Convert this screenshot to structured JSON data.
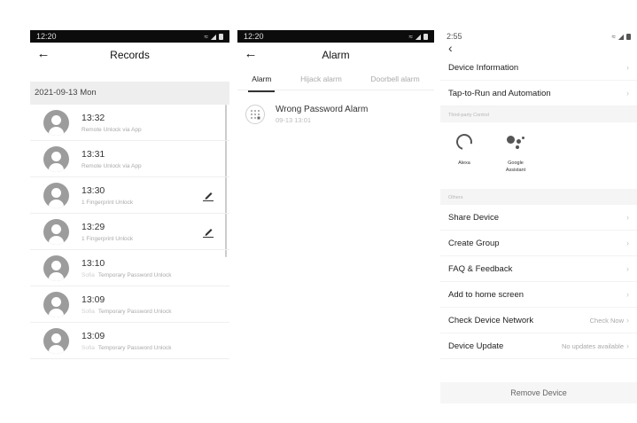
{
  "records_screen": {
    "status_time": "12:20",
    "title": "Records",
    "date_header": "2021-09-13 Mon",
    "records": [
      {
        "time": "13:32",
        "user": "",
        "method": "Remote Unlock via App",
        "editable": false
      },
      {
        "time": "13:31",
        "user": "",
        "method": "Remote Unlock via App",
        "editable": false
      },
      {
        "time": "13:30",
        "user": "",
        "method": "1 Fingerprint Unlock",
        "editable": true
      },
      {
        "time": "13:29",
        "user": "",
        "method": "1 Fingerprint Unlock",
        "editable": true
      },
      {
        "time": "13:10",
        "user": "Sofia",
        "method": "Temporary Password Unlock",
        "editable": false
      },
      {
        "time": "13:09",
        "user": "Sofia",
        "method": "Temporary Password Unlock",
        "editable": false
      },
      {
        "time": "13:09",
        "user": "Sofia",
        "method": "Temporary Password Unlock",
        "editable": false
      }
    ]
  },
  "alarm_screen": {
    "status_time": "12:20",
    "title": "Alarm",
    "tabs": [
      "Alarm",
      "Hijack alarm",
      "Doorbell alarm"
    ],
    "active_tab": 0,
    "alarms": [
      {
        "title": "Wrong Password Alarm",
        "date": "09-13 13:01"
      }
    ]
  },
  "settings_screen": {
    "status_time": "2:55",
    "top_items": [
      {
        "label": "Device Information"
      },
      {
        "label": "Tap-to-Run and Automation"
      }
    ],
    "third_party_header": "Third-party Control",
    "third_party": [
      {
        "label": "Alexa",
        "icon": "alexa-icon"
      },
      {
        "label": "Google Assistant",
        "icon": "google-assistant-icon"
      }
    ],
    "others_header": "Others",
    "other_items": [
      {
        "label": "Share Device",
        "value": ""
      },
      {
        "label": "Create Group",
        "value": ""
      },
      {
        "label": "FAQ & Feedback",
        "value": ""
      },
      {
        "label": "Add to home screen",
        "value": ""
      },
      {
        "label": "Check Device Network",
        "value": "Check Now"
      },
      {
        "label": "Device Update",
        "value": "No updates available"
      }
    ],
    "remove_label": "Remove Device"
  }
}
